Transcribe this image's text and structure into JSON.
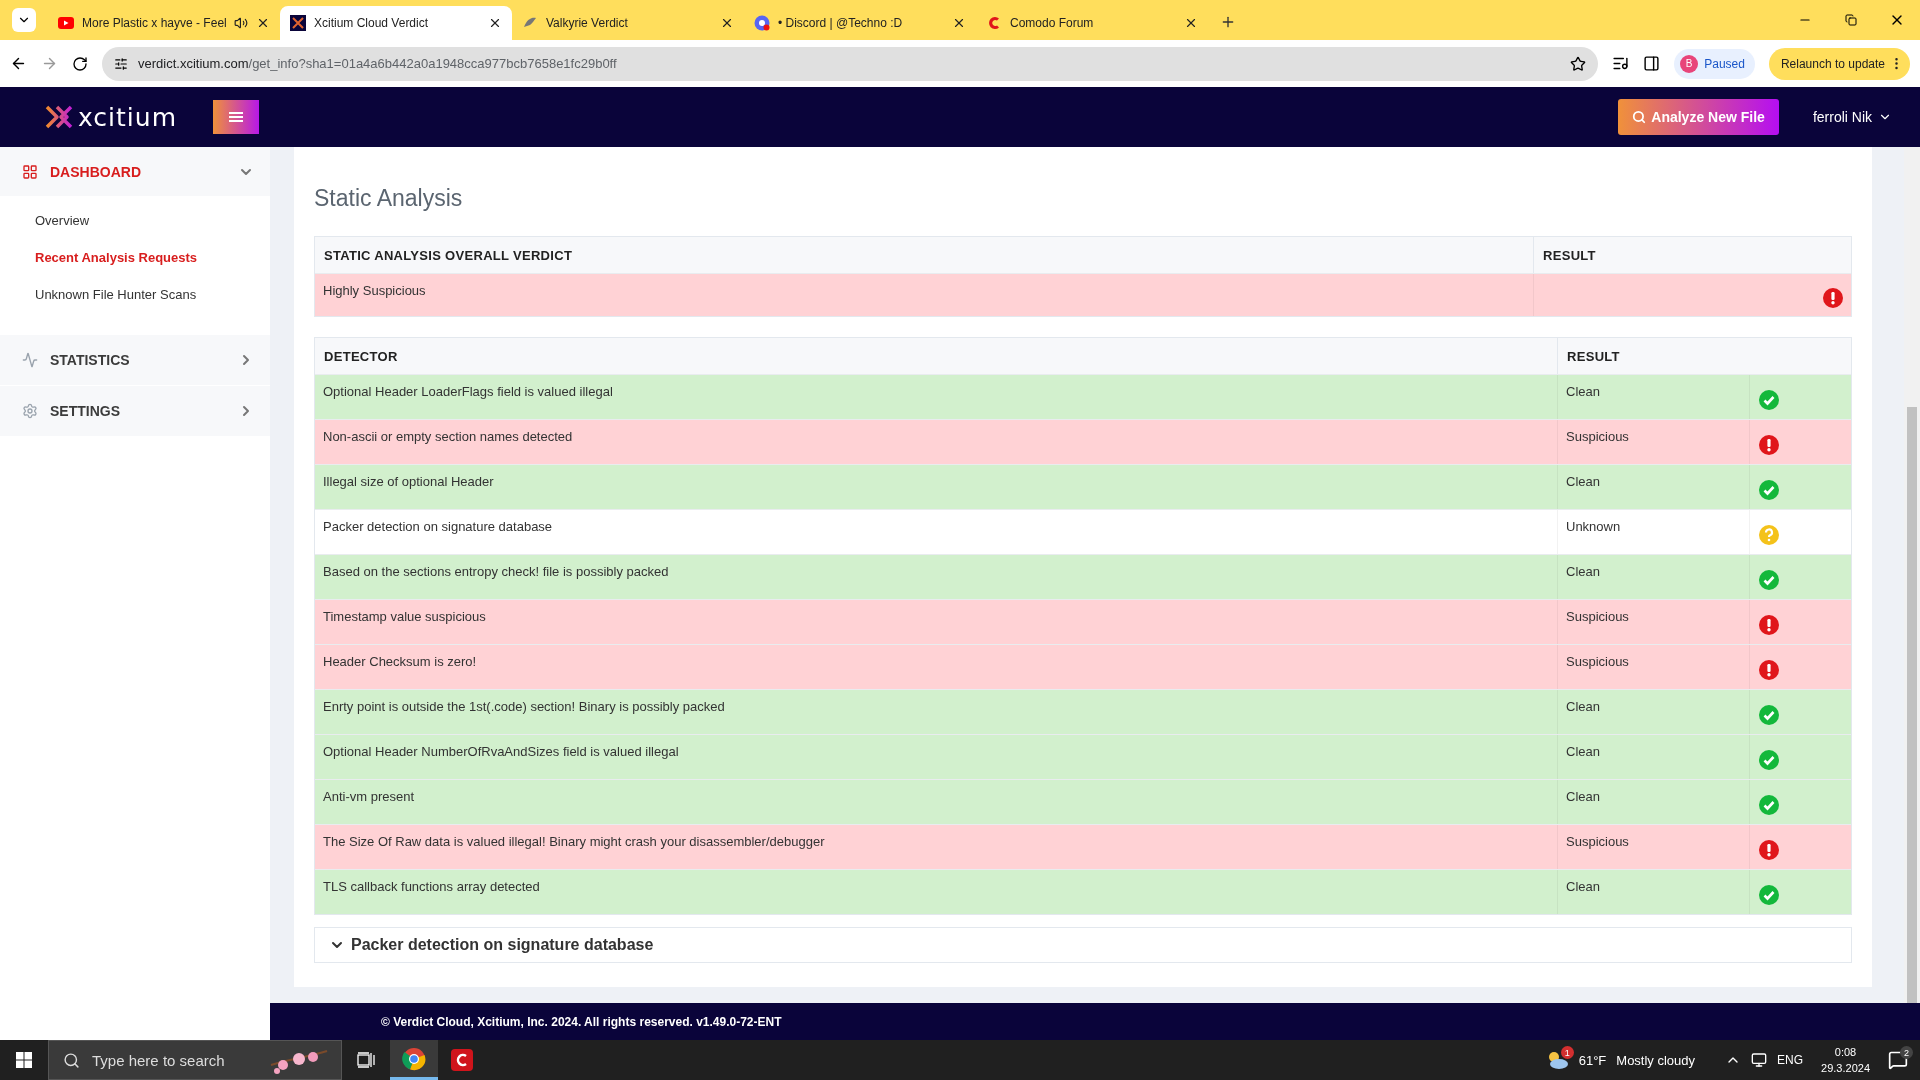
{
  "browser": {
    "tabs": [
      {
        "title": "More Plastic x hayve - Feel",
        "selected": false,
        "audio": true
      },
      {
        "title": "Xcitium Cloud Verdict",
        "selected": true,
        "audio": false
      },
      {
        "title": "Valkyrie Verdict",
        "selected": false,
        "audio": false
      },
      {
        "title": "• Discord | @Techno :D",
        "selected": false,
        "audio": false
      },
      {
        "title": "Comodo Forum",
        "selected": false,
        "audio": false
      }
    ],
    "url_host": "verdict.xcitium.com",
    "url_path": "/get_info?sha1=01a4a6b442a0a1948cca977bcb7658e1fc29b0ff",
    "profile_initial": "B",
    "profile_status": "Paused",
    "relaunch_button": "Relaunch to update"
  },
  "header": {
    "logo": "xcitium",
    "analyze_button": "Analyze New File",
    "user_menu": "ferroli Nik"
  },
  "sidebar": {
    "sections": [
      {
        "label": "DASHBOARD",
        "selected": true,
        "expanded": true,
        "items": [
          {
            "label": "Overview",
            "selected": false
          },
          {
            "label": "Recent Analysis Requests",
            "selected": true
          },
          {
            "label": "Unknown File Hunter Scans",
            "selected": false
          }
        ]
      },
      {
        "label": "STATISTICS",
        "selected": false,
        "expanded": false
      },
      {
        "label": "SETTINGS",
        "selected": false,
        "expanded": false
      }
    ]
  },
  "main": {
    "title": "Static Analysis",
    "verdict_table": {
      "columns": [
        "STATIC ANALYSIS OVERALL VERDICT",
        "RESULT"
      ],
      "rows": [
        {
          "verdict": "Highly Suspicious",
          "kind": "suspicious"
        }
      ]
    },
    "detector_table": {
      "columns": [
        "DETECTOR",
        "RESULT"
      ],
      "rows": [
        {
          "detector": "Optional Header LoaderFlags field is valued illegal",
          "result": "Clean",
          "kind": "clean"
        },
        {
          "detector": "Non-ascii or empty section names detected",
          "result": "Suspicious",
          "kind": "suspicious"
        },
        {
          "detector": "Illegal size of optional Header",
          "result": "Clean",
          "kind": "clean"
        },
        {
          "detector": "Packer detection on signature database",
          "result": "Unknown",
          "kind": "unknown"
        },
        {
          "detector": "Based on the sections entropy check! file is possibly packed",
          "result": "Clean",
          "kind": "clean"
        },
        {
          "detector": "Timestamp value suspicious",
          "result": "Suspicious",
          "kind": "suspicious"
        },
        {
          "detector": "Header Checksum is zero!",
          "result": "Suspicious",
          "kind": "suspicious"
        },
        {
          "detector": "Enrty point is outside the 1st(.code) section! Binary is possibly packed",
          "result": "Clean",
          "kind": "clean"
        },
        {
          "detector": "Optional Header NumberOfRvaAndSizes field is valued illegal",
          "result": "Clean",
          "kind": "clean"
        },
        {
          "detector": "Anti-vm present",
          "result": "Clean",
          "kind": "clean"
        },
        {
          "detector": "The Size Of Raw data is valued illegal! Binary might crash your disassembler/debugger",
          "result": "Suspicious",
          "kind": "suspicious"
        },
        {
          "detector": "TLS callback functions array detected",
          "result": "Clean",
          "kind": "clean"
        }
      ]
    },
    "accordion": {
      "title": "Packer detection on signature database",
      "expanded": false
    }
  },
  "footer": "© Verdict Cloud, Xcitium, Inc. 2024. All rights reserved. v1.49.0-72-ENT",
  "taskbar": {
    "search_placeholder": "Type here to search",
    "weather_badge": "1",
    "temperature": "61°F",
    "weather": "Mostly cloudy",
    "language": "ENG",
    "time": "0:08",
    "date": "29.3.2024",
    "notifications": "2"
  }
}
